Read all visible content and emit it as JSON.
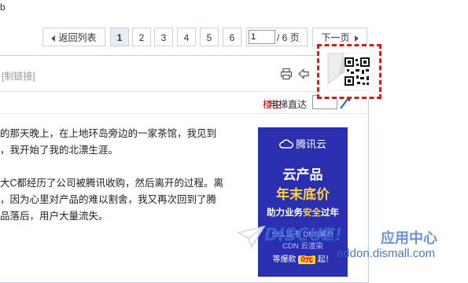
{
  "top_fragment": "b",
  "pager": {
    "back_label": "返回列表",
    "pages": [
      "1",
      "2",
      "3",
      "4",
      "5",
      "6"
    ],
    "active_page": "1",
    "page_input_value": "1",
    "total_label": "/ 6 页",
    "next_label": "下一页"
  },
  "post": {
    "copy_link_label": "[制链接]",
    "author_badge": "楼主",
    "elevator_label": "电梯直达",
    "paragraphs": [
      "的那天晚上，在上地环岛旁边的一家茶馆，我见到",
      "，我开始了我的北漂生涯。",
      "",
      "大C都经历了公司被腾讯收购，然后离开的过程。离",
      "，因为心里对产品的难以割舍，我又再次回到了腾",
      "品落后，用户大量流失。"
    ]
  },
  "ad": {
    "brand": "腾讯云",
    "line1": "云产品",
    "line2": "年末底价",
    "line3_a": "助力业务",
    "line3_hl": "安全",
    "line3_b": "过年",
    "line4": "SSL证书  DNS解析",
    "line5": "CDN  云渲染",
    "line6_a": "等爆款",
    "line6_pill": "0元",
    "line6_b": "起！"
  },
  "watermark": {
    "brand": "DISCUZ!",
    "app": "应用中心",
    "url": "addon.dismall.com"
  },
  "colors": {
    "border": "#c2d5e3",
    "author_red": "#dd0000",
    "ad_bg": "#2a2fb0",
    "ad_yellow": "#ffd53a",
    "callout_red": "#d51c1c",
    "watermark_blue": "#3a6ed1"
  }
}
